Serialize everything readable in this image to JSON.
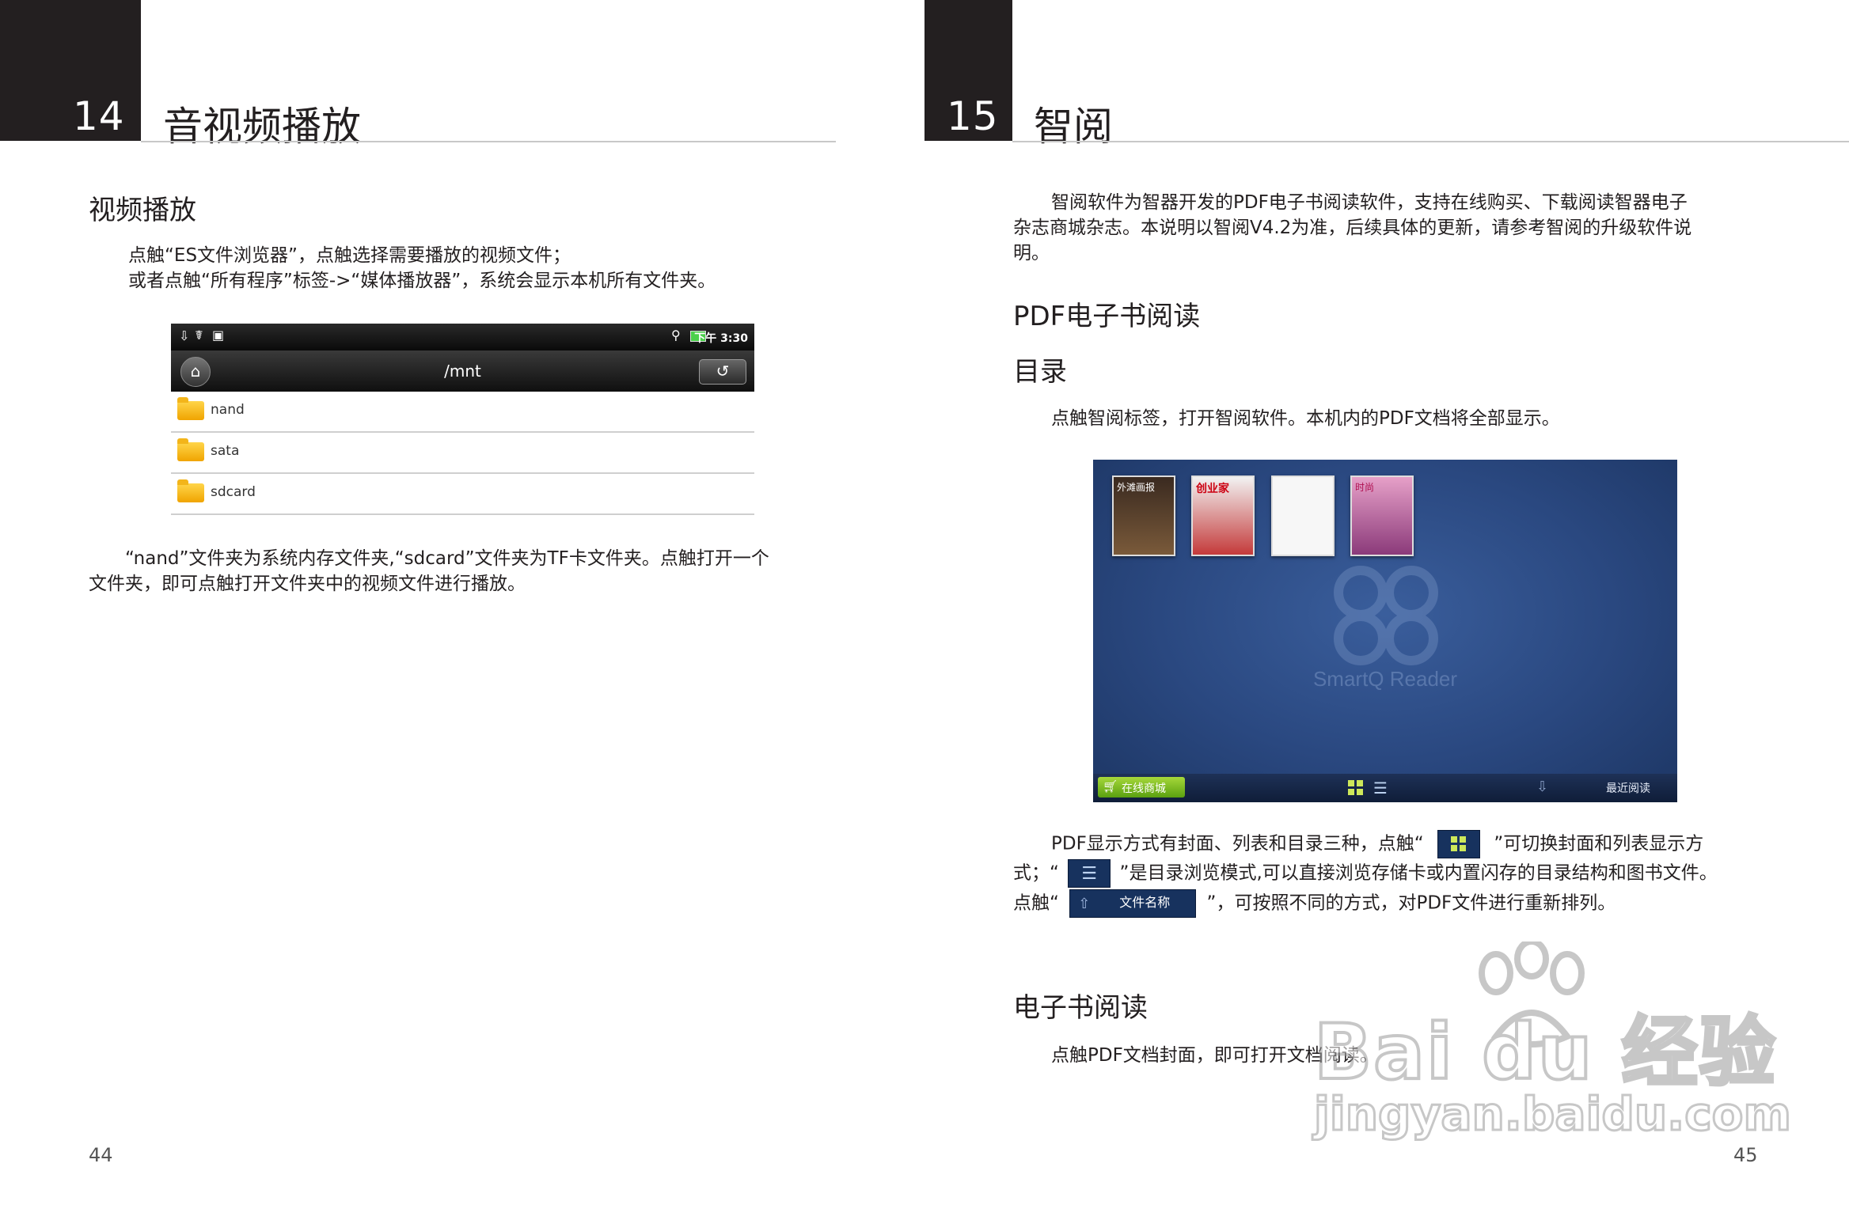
{
  "left": {
    "chapter_number": "14",
    "chapter_title": "音视频播放",
    "section_title": "视频播放",
    "para1_line1": "点触“ES文件浏览器”，点触选择需要播放的视频文件；",
    "para1_line2": "或者点触“所有程序”标签->“媒体播放器”，系统会显示本机所有文件夹。",
    "file_browser": {
      "status_time": "下午 3:30",
      "path": "/mnt",
      "folders": [
        "nand",
        "sata",
        "sdcard"
      ]
    },
    "para2_line1": "“nand”文件夹为系统内存文件夹,“sdcard”文件夹为TF卡文件夹。点触打开一个",
    "para2_line2": "文件夹，即可点触打开文件夹中的视频文件进行播放。",
    "page_number": "44"
  },
  "right": {
    "chapter_number": "15",
    "chapter_title": "智阅",
    "intro_line1": "智阅软件为智器开发的PDF电子书阅读软件，支持在线购买、下载阅读智器电子",
    "intro_line2": "杂志商城杂志。本说明以智阅V4.2为准，后续具体的更新，请参考智阅的升级软件说",
    "intro_line3": "明。",
    "section1_title": "PDF电子书阅读",
    "section2_title": "目录",
    "para_catalog": "点触智阅标签，打开智阅软件。本机内的PDF文档将全部显示。",
    "reader": {
      "covers": [
        "外滩画报",
        "创业家",
        "",
        "时尚"
      ],
      "logo_text": "SmartQ Reader",
      "online_store": "在线商城",
      "recent": "最近阅读"
    },
    "display_line1_a": "PDF显示方式有封面、列表和目录三种，点触“",
    "display_line1_b": "”可切换封面和列表显示方",
    "display_line2_a": "式；“",
    "display_line2_b": "”是目录浏览模式,可以直接浏览存储卡或内置闪存的目录结构和图书文件。",
    "display_line3_a": "点触“",
    "sort_button_label": "文件名称",
    "display_line3_b": "”，可按照不同的方式，对PDF文件进行重新排列。",
    "section3_title": "电子书阅读",
    "para_read": "点触PDF文档封面，即可打开文档阅读。",
    "page_number": "45",
    "watermark_brand": "Bai du 经验",
    "watermark_url": "jingyan.baidu.com"
  }
}
